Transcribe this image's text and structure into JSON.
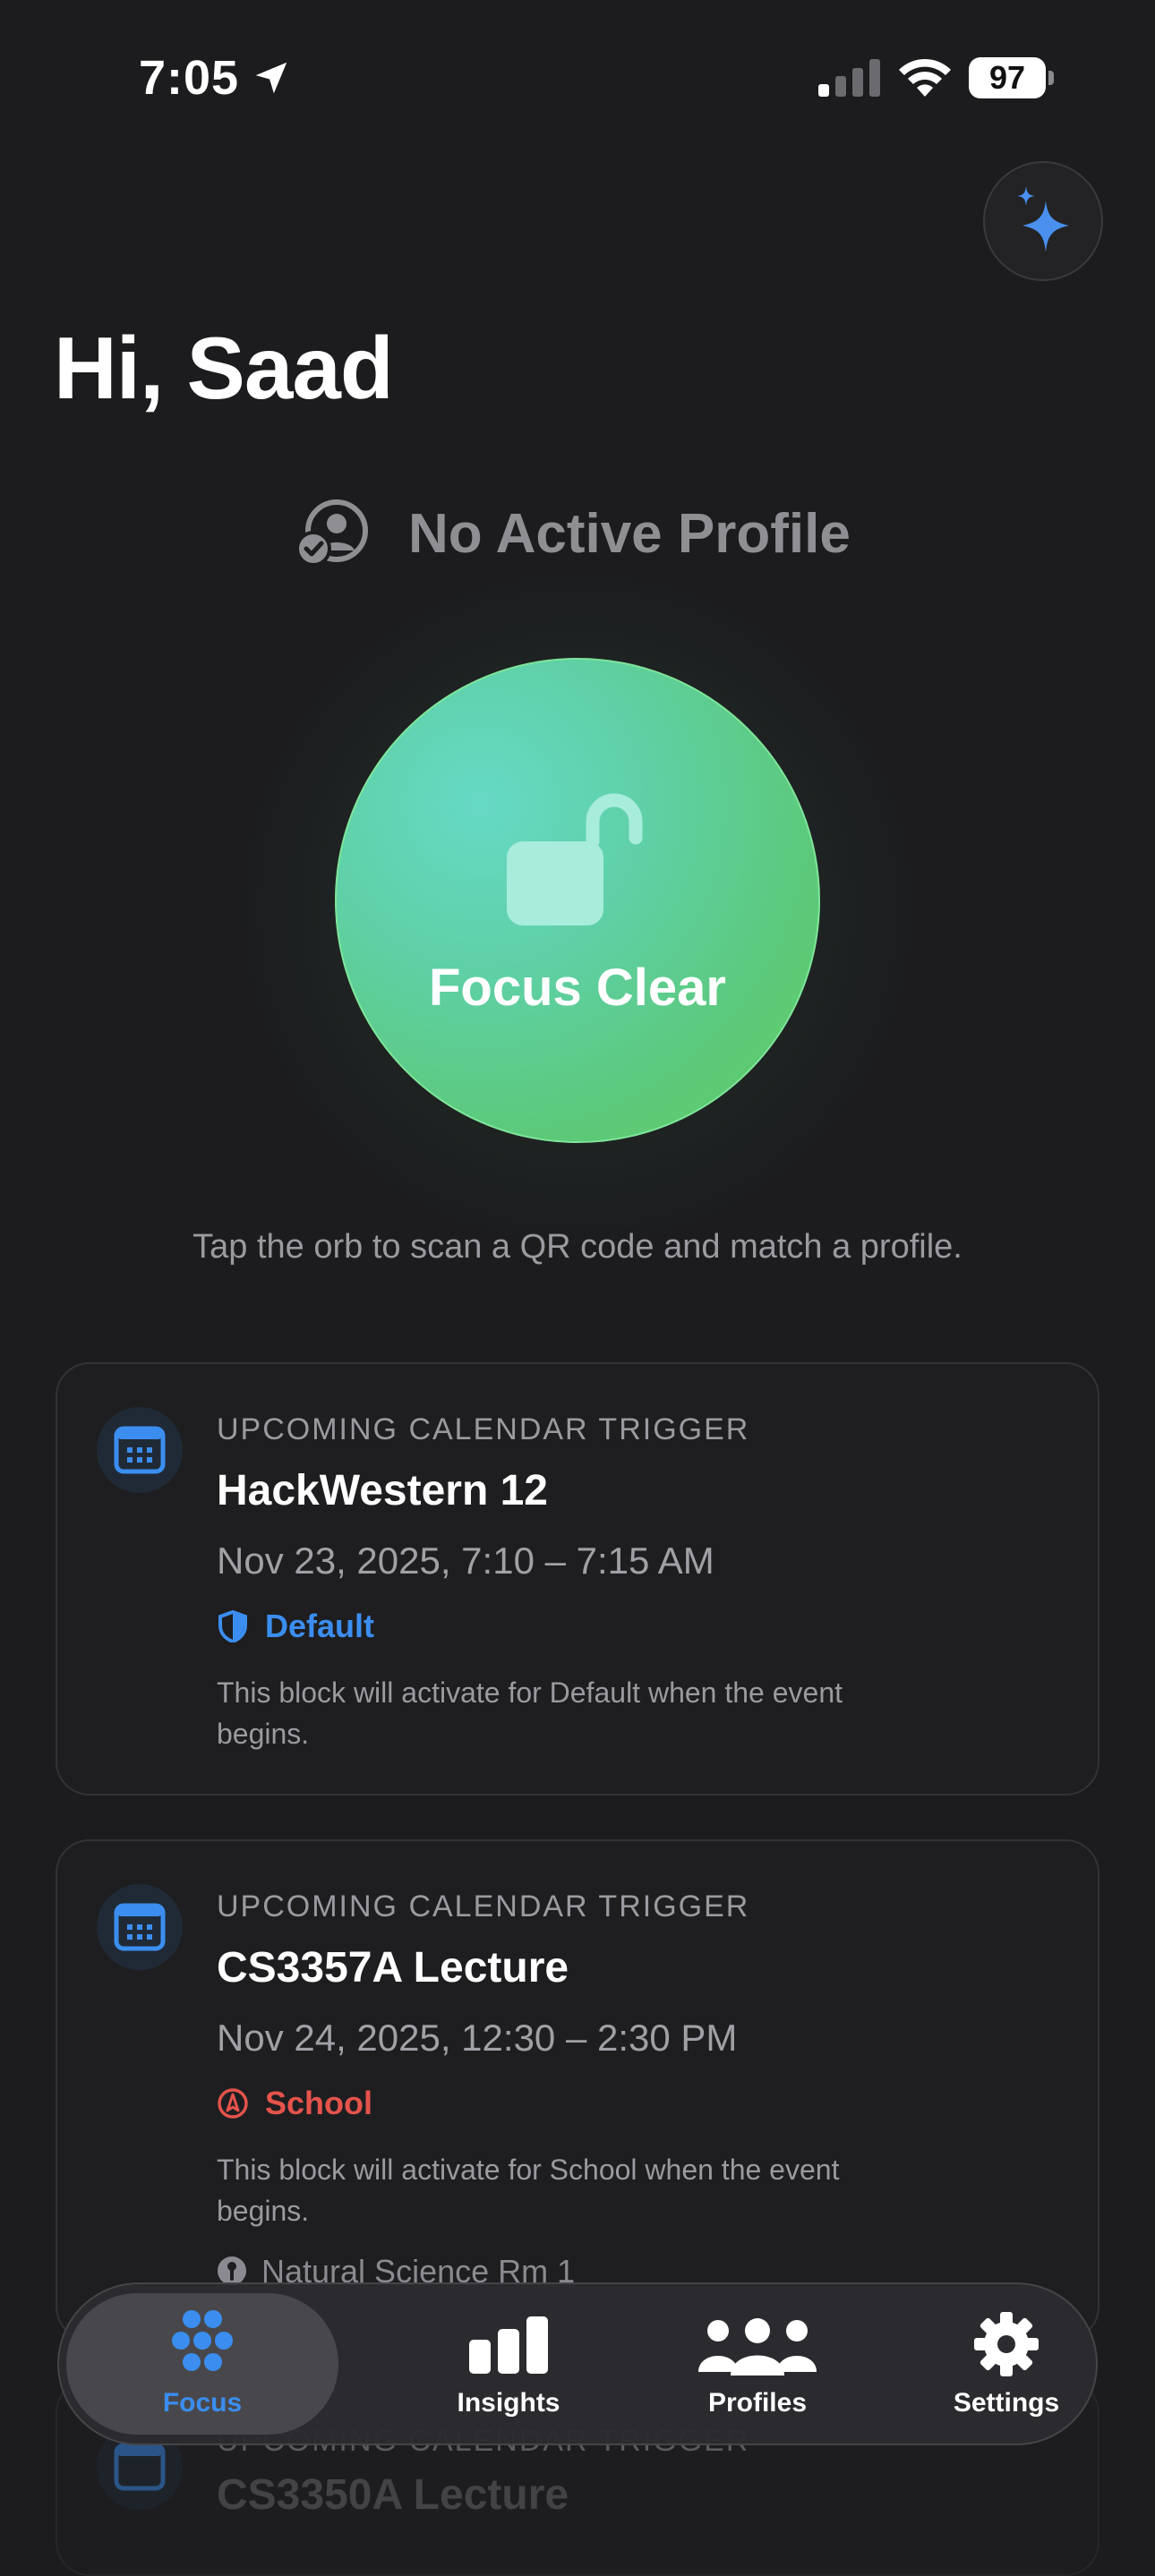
{
  "status_bar": {
    "time": "7:05",
    "battery": "97"
  },
  "header": {
    "greeting": "Hi, Saad"
  },
  "profile_status": {
    "label": "No Active Profile"
  },
  "orb": {
    "label": "Focus Clear",
    "hint": "Tap the orb to scan a QR code and match a profile."
  },
  "cards": [
    {
      "kicker": "UPCOMING CALENDAR TRIGGER",
      "title": "HackWestern 12",
      "time": "Nov 23, 2025, 7:10 – 7:15 AM",
      "profile": "Default",
      "profile_color": "#3b8ef0",
      "profile_icon": "shield-icon",
      "description": "This block will activate for Default when the event begins."
    },
    {
      "kicker": "UPCOMING CALENDAR TRIGGER",
      "title": "CS3357A Lecture",
      "time": "Nov 24, 2025, 12:30 – 2:30 PM",
      "profile": "School",
      "profile_color": "#e5534b",
      "profile_icon": "compass-icon",
      "description": "This block will activate for School when the event begins.",
      "location": "Natural Science Rm 1"
    },
    {
      "kicker": "UPCOMING CALENDAR TRIGGER",
      "title": "CS3350A Lecture"
    }
  ],
  "tabbar": {
    "active": "Focus",
    "accent": "#3b8ef0",
    "tabs": [
      {
        "label": "Focus",
        "icon": "hexagon-cluster-icon"
      },
      {
        "label": "Insights",
        "icon": "bar-chart-icon"
      },
      {
        "label": "Profiles",
        "icon": "people-icon"
      },
      {
        "label": "Settings",
        "icon": "gear-icon"
      }
    ]
  }
}
